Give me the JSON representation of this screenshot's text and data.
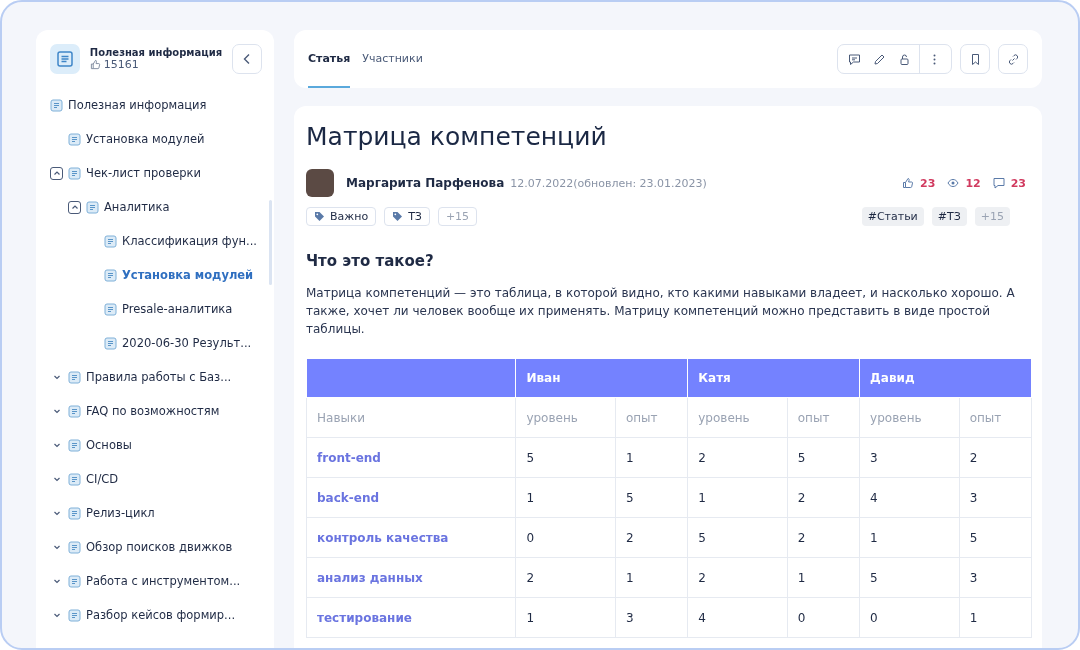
{
  "space": {
    "title": "Полезная информация",
    "likes": "15161"
  },
  "tree": [
    {
      "label": "Полезная информация",
      "selected": false,
      "children": [
        {
          "label": "Установка модулей",
          "selected": false
        },
        {
          "label": "Чек-лист проверки",
          "selected": false,
          "expanded": true,
          "children": [
            {
              "label": "Аналитика",
              "selected": false,
              "expanded": true,
              "children": [
                {
                  "label": "Классификация фун...",
                  "selected": false
                },
                {
                  "label": "Установка модулей",
                  "selected": true
                },
                {
                  "label": "Presale-аналитика",
                  "selected": false
                },
                {
                  "label": "2020-06-30 Результ...",
                  "selected": false
                }
              ]
            }
          ]
        },
        {
          "label": "Правила работы с Баз...",
          "selected": false,
          "expanded": false
        },
        {
          "label": "FAQ по возможностям",
          "selected": false,
          "expanded": false
        },
        {
          "label": "Основы",
          "selected": false,
          "expanded": false
        },
        {
          "label": "CI/CD",
          "selected": false,
          "expanded": false
        },
        {
          "label": "Релиз-цикл",
          "selected": false,
          "expanded": false
        },
        {
          "label": "Обзор поисков движков",
          "selected": false,
          "expanded": false
        },
        {
          "label": "Работа с инструментом...",
          "selected": false,
          "expanded": false
        },
        {
          "label": "Разбор кейсов формир...",
          "selected": false,
          "expanded": false
        }
      ]
    }
  ],
  "tabs": [
    {
      "label": "Статья",
      "selected": true
    },
    {
      "label": "Участники",
      "selected": false
    }
  ],
  "article": {
    "title": "Матрица компетенций",
    "author": "Маргарита Парфенова",
    "date": "12.07.2022(обновлен: 23.01.2023)",
    "likes": "23",
    "views": "12",
    "comments": "23",
    "labels": [
      "Важно",
      "ТЗ"
    ],
    "labels_more": "+15",
    "hashtags": [
      "#Статьи",
      "#ТЗ"
    ],
    "hashtags_more": "+15",
    "heading": "Что это такое?",
    "paragraph": "Матрица компетенций — это таблица, в которой видно, кто какими навыками владеет, и насколько хорошо. А также, хочет ли человек вообще их применять. Матрицу компетенций можно представить в виде простой таблицы."
  },
  "table": {
    "people": [
      "Иван",
      "Катя",
      "Давид"
    ],
    "columns": [
      "Навыки",
      "уровень",
      "опыт",
      "уровень",
      "опыт",
      "уровень",
      "опыт"
    ],
    "rows": [
      [
        "front-end",
        "5",
        "1",
        "2",
        "5",
        "3",
        "2"
      ],
      [
        "back-end",
        "1",
        "5",
        "1",
        "2",
        "4",
        "3"
      ],
      [
        "контроль качества",
        "0",
        "2",
        "5",
        "2",
        "1",
        "5"
      ],
      [
        "анализ данных",
        "2",
        "1",
        "2",
        "1",
        "5",
        "3"
      ],
      [
        "тестирование",
        "1",
        "3",
        "4",
        "0",
        "0",
        "1"
      ]
    ]
  }
}
